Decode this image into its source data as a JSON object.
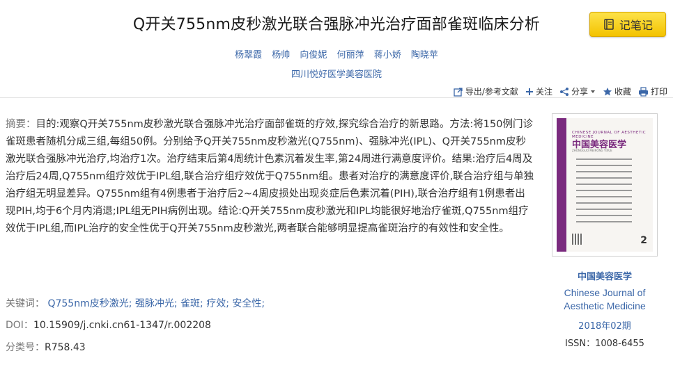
{
  "article": {
    "title": "Q开关755nm皮秒激光联合强脉冲光治疗面部雀斑临床分析",
    "authors": [
      "杨翠霞",
      "杨帅",
      "向俊妮",
      "何丽萍",
      "蒋小娇",
      "陶晓苹"
    ],
    "affiliation": "四川悦好医学美容医院"
  },
  "note_button": {
    "label": "记笔记"
  },
  "toolbar": {
    "export": "导出/参考文献",
    "follow": "关注",
    "share": "分享",
    "favorite": "收藏",
    "print": "打印"
  },
  "abstract": {
    "label": "摘要：",
    "text": "目的:观察Q开关755nm皮秒激光联合强脉冲光治疗面部雀斑的疗效,探究综合治疗的新思路。方法:将150例门诊雀斑患者随机分成三组,每组50例。分别给予Q开关755nm皮秒激光(Q755nm)、强脉冲光(IPL)、Q开关755nm皮秒激光联合强脉冲光治疗,均治疗1次。治疗结束后第4周统计色素沉着发生率,第24周进行满意度评价。结果:治疗后4周及治疗后24周,Q755nm组疗效优于IPL组,联合治疗组疗效优于Q755nm组。患者对治疗的满意度评价,联合治疗组与单独治疗组无明显差异。Q755nm组有4例患者于治疗后2~4周皮损处出现炎症后色素沉着(PIH),联合治疗组有1例患者出现PIH,均于6个月内消退;IPL组无PIH病例出现。结论:Q开关755nm皮秒激光和IPL均能很好地治疗雀斑,Q755nm组疗效优于IPL组,而IPL治疗的安全性优于Q开关755nm皮秒激光,两者联合能够明显提高雀斑治疗的有效性和安全性。"
  },
  "keywords": {
    "label": "关键词：",
    "items": [
      "Q755nm皮秒激光;",
      "强脉冲光;",
      "雀斑;",
      "疗效;",
      "安全性;"
    ]
  },
  "doi": {
    "label": "DOI：",
    "value": "10.15909/j.cnki.cn61-1347/r.002208"
  },
  "classification": {
    "label": "分类号：",
    "value": "R758.43"
  },
  "journal": {
    "name_cn": "中国美容医学",
    "name_en": "Chinese Journal of Aesthetic Medicine",
    "issue": "2018年02期",
    "issn": "ISSN：1008-6455",
    "cover_name_en": "CHINESE JOURNAL OF AESTHETIC MEDICINE",
    "cover_name_cn": "中国美容医学",
    "cover_pinyin": "ZHONGGUO MEIRONG YIXUE",
    "cover_vol": "2"
  },
  "colors": {
    "link": "#3b67a8",
    "button": "#f3c300",
    "cover_band": "#7a2a7e"
  },
  "icons": [
    "notebook-icon",
    "export-icon",
    "plus-icon",
    "share-icon",
    "star-icon",
    "printer-icon"
  ]
}
